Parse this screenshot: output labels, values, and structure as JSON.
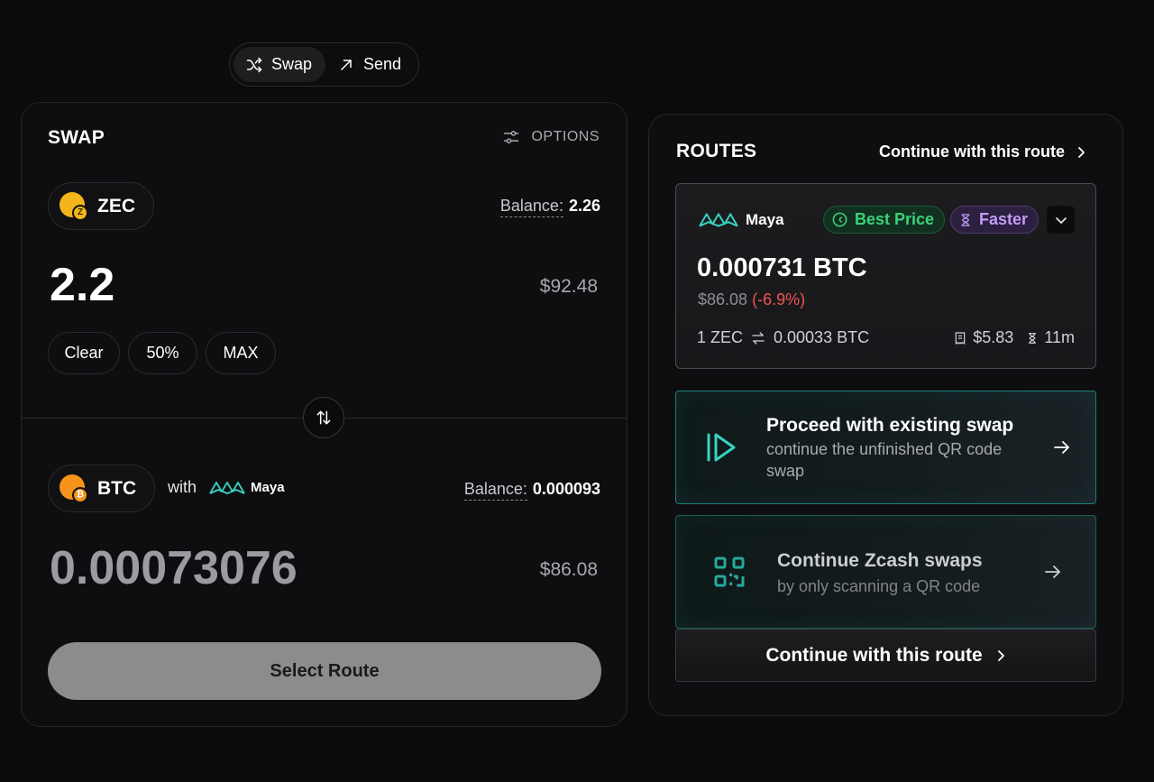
{
  "mode_toggle": {
    "swap_label": "Swap",
    "send_label": "Send",
    "active": "Swap"
  },
  "swap": {
    "title": "SWAP",
    "options_label": "OPTIONS",
    "from": {
      "token": "ZEC",
      "balance_label": "Balance:",
      "balance_value": "2.26",
      "amount": "2.2",
      "fiat": "$92.48"
    },
    "quick_buttons": [
      "Clear",
      "50%",
      "MAX"
    ],
    "to": {
      "token": "BTC",
      "with_label": "with",
      "provider": "Maya",
      "balance_label": "Balance:",
      "balance_value": "0.000093",
      "amount": "0.00073076",
      "fiat": "$86.08"
    },
    "select_route_label": "Select Route"
  },
  "routes": {
    "title": "ROUTES",
    "continue_label": "Continue with this route",
    "best": {
      "provider": "Maya",
      "badge_best": "Best Price",
      "badge_fast": "Faster",
      "amount": "0.000731 BTC",
      "fiat": "$86.08",
      "change": "(-6.9%)",
      "rate_from": "1 ZEC",
      "rate_to": "0.00033 BTC",
      "fee": "$5.83",
      "time": "11m"
    },
    "promo_existing": {
      "title": "Proceed with existing swap",
      "desc": "continue the unfinished QR code swap"
    },
    "promo_zcash": {
      "title": "Continue Zcash swaps",
      "desc": "by only scanning a QR code"
    },
    "continue_bottom_label": "Continue with this route"
  },
  "colors": {
    "background": "#0b0b0c",
    "accent_teal": "#38d3c0",
    "best_price_green": "#3fd07a",
    "faster_purple": "#c29cf5",
    "negative_red": "#ef5350"
  }
}
